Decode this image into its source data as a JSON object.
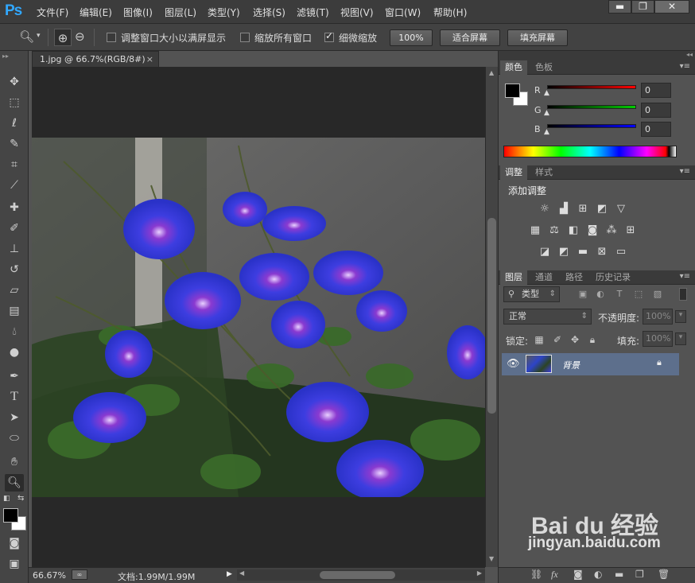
{
  "app": {
    "logo": "Ps"
  },
  "menu": [
    "文件(F)",
    "编辑(E)",
    "图像(I)",
    "图层(L)",
    "类型(Y)",
    "选择(S)",
    "滤镜(T)",
    "视图(V)",
    "窗口(W)",
    "帮助(H)"
  ],
  "window_controls": {
    "minimize": "▬",
    "restore": "❐",
    "close": "✕"
  },
  "options": {
    "resize_windows_label": "调整窗口大小以满屏显示",
    "resize_windows_checked": false,
    "zoom_all_label": "缩放所有窗口",
    "zoom_all_checked": false,
    "scrubby_zoom_label": "细微缩放",
    "scrubby_zoom_checked": true,
    "btn_100": "100%",
    "btn_fit": "适合屏幕",
    "btn_fill": "填充屏幕"
  },
  "document": {
    "tab_title": "1.jpg @ 66.7%(RGB/8#)",
    "tab_close": "×",
    "zoom": "66.67%",
    "doc_info": "文档:1.99M/1.99M"
  },
  "color_panel": {
    "tabs": [
      "颜色",
      "色板"
    ],
    "labels": [
      "R",
      "G",
      "B"
    ],
    "values": [
      "0",
      "0",
      "0"
    ],
    "slider_colors": [
      "#ff0000",
      "#00cc00",
      "#0000ff"
    ]
  },
  "adjust_panel": {
    "tabs": [
      "调整",
      "样式"
    ],
    "heading": "添加调整"
  },
  "layers_panel": {
    "tabs": [
      "图层",
      "通道",
      "路径",
      "历史记录"
    ],
    "filter_kind": "类型",
    "blend_mode": "正常",
    "opacity_label": "不透明度:",
    "opacity_value": "100%",
    "lock_label": "锁定:",
    "fill_label": "填充:",
    "fill_value": "100%",
    "layers": [
      {
        "name": "背景",
        "visible": true,
        "locked": true
      }
    ]
  },
  "watermark": {
    "text": "jingyan.baidu.com",
    "logo": "Bai du 经验"
  },
  "colors": {
    "accent": "#31a8ff",
    "selected_layer": "#5d6f8c"
  }
}
